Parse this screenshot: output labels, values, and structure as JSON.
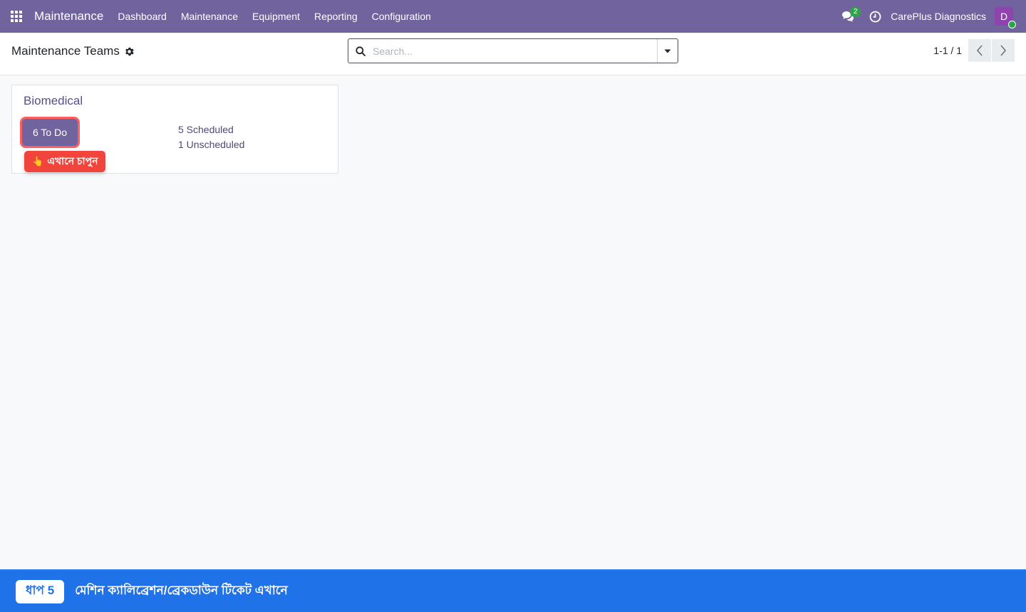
{
  "navbar": {
    "app_name": "Maintenance",
    "menu": [
      {
        "label": "Dashboard"
      },
      {
        "label": "Maintenance"
      },
      {
        "label": "Equipment"
      },
      {
        "label": "Reporting"
      },
      {
        "label": "Configuration"
      }
    ],
    "chat_count": "2",
    "company": "CarePlus Diagnostics",
    "avatar_letter": "D",
    "icons": {
      "apps": "apps-grid-icon",
      "chat": "chat-icon",
      "activity": "clock-icon"
    },
    "colors": {
      "bar": "#71639e",
      "avatar": "#8e44ad",
      "badge": "#28a745"
    }
  },
  "control_panel": {
    "title": "Maintenance Teams",
    "search_placeholder": "Search...",
    "pager_value": "1-1 / 1"
  },
  "card": {
    "team_name": "Biomedical",
    "todo_label": "6 To Do",
    "scheduled": "5 Scheduled",
    "unscheduled": "1 Unscheduled",
    "hint": "এখানে চাপুন",
    "hint_icon": "👆"
  },
  "step_banner": {
    "badge": "ধাপ 5",
    "text": "মেশিন ক্যালিব্রেশন/ব্রেকডাউন টিকেট এখানে",
    "color": "#1f72e8"
  }
}
